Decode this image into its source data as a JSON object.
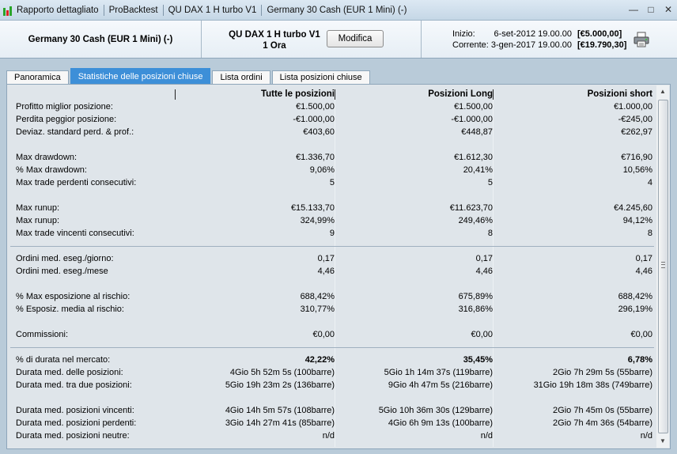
{
  "titlebar": {
    "title": "Rapporto dettagliato",
    "tabs": [
      "ProBacktest",
      "QU  DAX 1 H turbo V1",
      "Germany 30 Cash (EUR 1 Mini) (-)"
    ]
  },
  "header": {
    "instrument": "Germany 30 Cash (EUR 1 Mini) (-)",
    "strategy_name": "QU  DAX 1 H turbo V1",
    "timeframe": "1 Ora",
    "modify_label": "Modifica",
    "start_label": "Inizio:",
    "start_date": "6-set-2012 19.00.00",
    "start_capital": "[€5.000,00]",
    "current_label": "Corrente:",
    "current_date": "3-gen-2017 19.00.00",
    "current_capital": "[€19.790,30]"
  },
  "tabs": [
    {
      "label": "Panoramica",
      "active": false
    },
    {
      "label": "Statistiche delle posizioni chiuse",
      "active": true
    },
    {
      "label": "Lista ordini",
      "active": false
    },
    {
      "label": "Lista posizioni chiuse",
      "active": false
    }
  ],
  "table": {
    "columns": [
      "Tutte le posizioni",
      "Posizioni Long",
      "Posizioni short"
    ],
    "rows": [
      {
        "label": "Profitto miglior posizione:",
        "all": "€1.500,00",
        "long": "€1.500,00",
        "short": "€1.000,00"
      },
      {
        "label": "Perdita peggior posizione:",
        "all": "-€1.000,00",
        "long": "-€1.000,00",
        "short": "-€245,00"
      },
      {
        "label": "Deviaz. standard perd. & prof.:",
        "all": "€403,60",
        "long": "€448,87",
        "short": "€262,97"
      },
      {
        "label": "Max drawdown:",
        "all": "€1.336,70",
        "long": "€1.612,30",
        "short": "€716,90"
      },
      {
        "label": "% Max drawdown:",
        "all": "9,06%",
        "long": "20,41%",
        "short": "10,56%"
      },
      {
        "label": "Max trade perdenti consecutivi:",
        "all": "5",
        "long": "5",
        "short": "4"
      },
      {
        "label": "Max runup:",
        "all": "€15.133,70",
        "long": "€11.623,70",
        "short": "€4.245,60"
      },
      {
        "label": "Max runup:",
        "all": "324,99%",
        "long": "249,46%",
        "short": "94,12%"
      },
      {
        "label": "Max trade vincenti consecutivi:",
        "all": "9",
        "long": "8",
        "short": "8"
      },
      {
        "label": "Ordini med. eseg./giorno:",
        "all": "0,17",
        "long": "0,17",
        "short": "0,17"
      },
      {
        "label": "Ordini med. eseg./mese",
        "all": "4,46",
        "long": "4,46",
        "short": "4,46"
      },
      {
        "label": "% Max esposizione al rischio:",
        "all": "688,42%",
        "long": "675,89%",
        "short": "688,42%"
      },
      {
        "label": "% Esposiz. media al rischio:",
        "all": "310,77%",
        "long": "316,86%",
        "short": "296,19%"
      },
      {
        "label": "Commissioni:",
        "all": "€0,00",
        "long": "€0,00",
        "short": "€0,00"
      },
      {
        "label": "% di durata nel mercato:",
        "all": "42,22%",
        "long": "35,45%",
        "short": "6,78%"
      },
      {
        "label": "Durata med. delle posizioni:",
        "all": "4Gio 5h 52m 5s (100barre)",
        "long": "5Gio 1h 14m 37s (119barre)",
        "short": "2Gio 7h 29m 5s (55barre)"
      },
      {
        "label": "Durata med. tra due posizioni:",
        "all": "5Gio 19h 23m 2s (136barre)",
        "long": "9Gio 4h 47m 5s (216barre)",
        "short": "31Gio 19h 18m 38s (749barre)"
      },
      {
        "label": "Durata med. posizioni vincenti:",
        "all": "4Gio 14h 5m 57s (108barre)",
        "long": "5Gio 10h 36m 30s (129barre)",
        "short": "2Gio 7h 45m 0s (55barre)"
      },
      {
        "label": "Durata med. posizioni perdenti:",
        "all": "3Gio 14h 27m 41s (85barre)",
        "long": "4Gio 6h 9m 13s (100barre)",
        "short": "2Gio 7h 4m 36s (54barre)"
      },
      {
        "label": "Durata med. posizioni neutre:",
        "all": "n/d",
        "long": "n/d",
        "short": "n/d"
      }
    ]
  }
}
